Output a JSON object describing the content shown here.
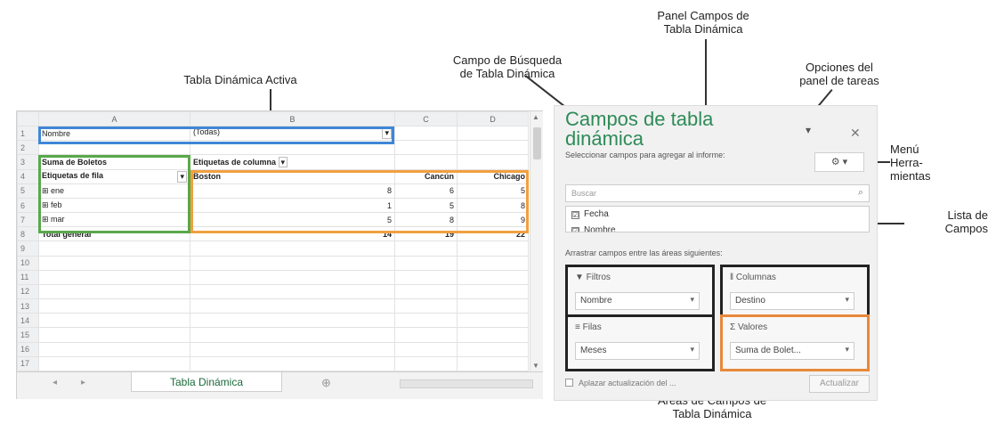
{
  "callouts": {
    "panel": "Panel Campos de\nTabla Dinámica",
    "active_pivot": "Tabla Dinámica Activa",
    "search_field": "Campo de Búsqueda\nde Tabla Dinámica",
    "task_options": "Opciones del\npanel de tareas",
    "tools_menu": "Menú\nHerra-\nmientas",
    "field_list": "Lista de\nCampos",
    "areas": "Áreas de Campos de\nTabla Dinámica"
  },
  "sheet": {
    "columns": [
      "A",
      "B",
      "C",
      "D"
    ],
    "rows": [
      {
        "n": "1",
        "a": "Nombre",
        "b": "(Todas)",
        "b_dd": "▾",
        "c": "",
        "d": ""
      },
      {
        "n": "2",
        "a": "",
        "b": "",
        "c": "",
        "d": ""
      },
      {
        "n": "3",
        "a": "Suma de Boletos",
        "b": "Etiquetas de columna",
        "b_dd": "▾",
        "c": "",
        "d": ""
      },
      {
        "n": "4",
        "a": "Etiquetas de fila",
        "a_dd": "▾",
        "b": "Boston",
        "c": "Cancún",
        "d": "Chicago"
      },
      {
        "n": "5",
        "a": "⊞ ene",
        "b": "8",
        "c": "6",
        "d": "5"
      },
      {
        "n": "6",
        "a": "⊞ feb",
        "b": "1",
        "c": "5",
        "d": "8"
      },
      {
        "n": "7",
        "a": "⊞ mar",
        "b": "5",
        "c": "8",
        "d": "9"
      },
      {
        "n": "8",
        "a": "Total general",
        "b": "14",
        "c": "19",
        "d": "22"
      },
      {
        "n": "9"
      },
      {
        "n": "10"
      },
      {
        "n": "11"
      },
      {
        "n": "12"
      },
      {
        "n": "13"
      },
      {
        "n": "14"
      },
      {
        "n": "15"
      },
      {
        "n": "16"
      },
      {
        "n": "17"
      }
    ],
    "tab_label": "Tabla Dinámica",
    "tab_prev": "◂",
    "tab_next": "▸",
    "add_sheet": "⊕"
  },
  "pane": {
    "title": "Campos de tabla dinámica",
    "subtitle": "Seleccionar campos para agregar al informe:",
    "tools_label": "⚙ ▾",
    "close": "✕",
    "gear": "▾",
    "search_placeholder": "Buscar",
    "fields": [
      {
        "label": "Fecha",
        "checked": "☑"
      },
      {
        "label": "Nombre",
        "checked": "☑"
      }
    ],
    "drag_hint": "Arrastrar campos entre las áreas siguientes:",
    "areas": {
      "filters": {
        "label": "▼ Filtros",
        "value": "Nombre"
      },
      "columns": {
        "label": "‖ Columnas",
        "value": "Destino"
      },
      "rows": {
        "label": "≡ Filas",
        "value": "Meses"
      },
      "values": {
        "label": "Σ Valores",
        "value": "Suma de Bolet..."
      }
    },
    "defer_label": "Aplazar actualización del ...",
    "update_label": "Actualizar"
  },
  "colors": {
    "blue": "#3f86d8",
    "green": "#59a84b",
    "orange": "#f0a040",
    "title_green": "#2e8b57"
  }
}
